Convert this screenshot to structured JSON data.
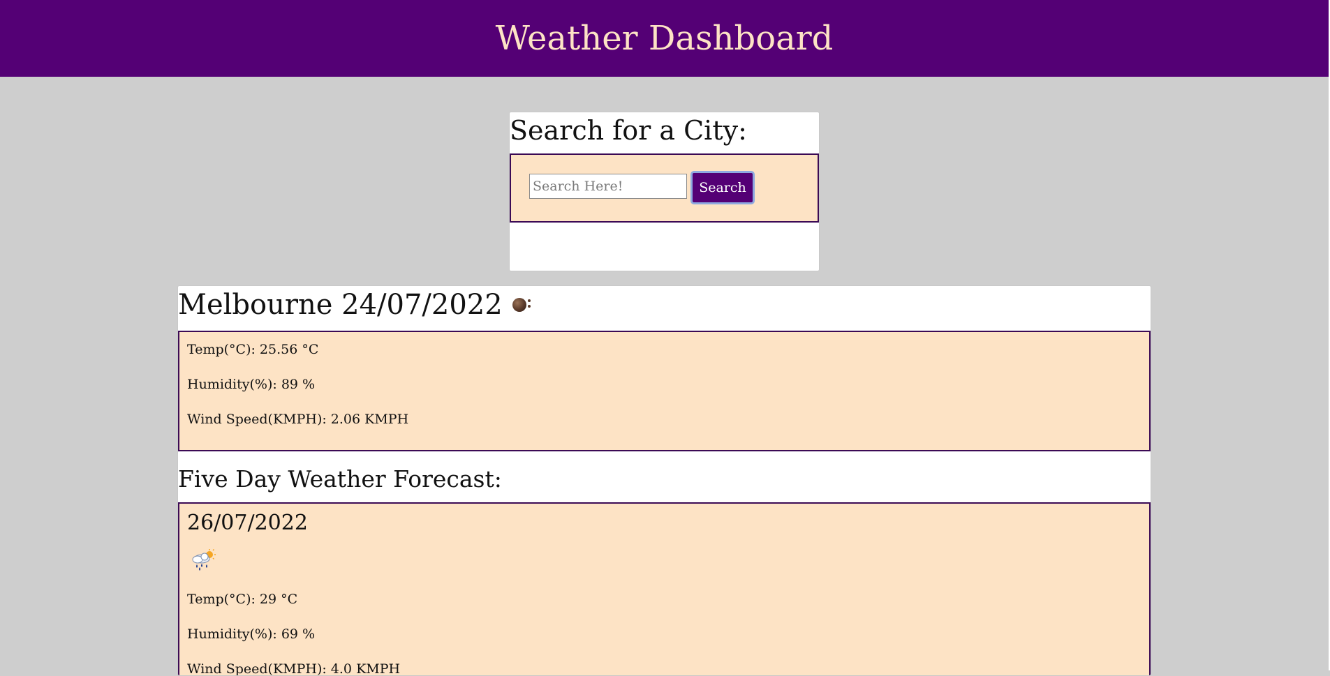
{
  "header": {
    "title": "Weather Dashboard",
    "bg_color": "#540075",
    "title_color": "#fde3c5"
  },
  "search": {
    "heading": "Search for a City:",
    "input_value": "",
    "placeholder": "Search Here!",
    "button_label": "Search"
  },
  "current": {
    "title": "Melbourne 24/07/2022",
    "icon": "weather-condition-icon",
    "temp": "Temp(°C): 25.56 °C",
    "humidity": "Humidity(%): 89 %",
    "wind": "Wind Speed(KMPH): 2.06 KMPH"
  },
  "forecast": {
    "heading": "Five Day Weather Forecast:",
    "days": [
      {
        "date": "26/07/2022",
        "icon": "rain-sun-icon",
        "temp": "Temp(°C): 29 °C",
        "humidity": "Humidity(%): 69 %",
        "wind": "Wind Speed(KMPH): 4.0 KMPH"
      }
    ]
  },
  "colors": {
    "page_bg": "#cecece",
    "panel_bg": "#fde3c5",
    "panel_border": "#3b0a55",
    "button_bg": "#540075"
  }
}
